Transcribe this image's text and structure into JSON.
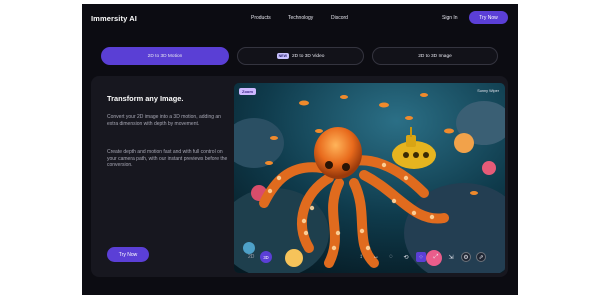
{
  "header": {
    "logo": "Immersity AI",
    "nav": [
      "Products",
      "Technology",
      "Discord"
    ],
    "signin": "Sign In",
    "try_now": "Try Now"
  },
  "tabs": [
    {
      "label": "2D to 3D Motion",
      "active": true
    },
    {
      "label": "2D to 3D Video",
      "badge": "NEW"
    },
    {
      "label": "2D to 3D Image"
    }
  ],
  "feature": {
    "title": "Transform any Image.",
    "paragraph_1": "Convert your 2D image into a 3D motion, adding an extra dimension with depth by movement.",
    "paragraph_2": "Create depth and motion fast and with full control on your camera path, with our instant previews before the conversion.",
    "cta": "Try Now"
  },
  "media": {
    "badge": "Zoom",
    "credit": "Sunny Wiper",
    "toolbar": {
      "mode_2d": "2D",
      "mode_3d": "3D",
      "tools": [
        "vertical-arrows-icon",
        "horizontal-arrows-icon",
        "circle-path-icon",
        "orbit-icon",
        "zoom-grid-icon",
        "expand-icon",
        "dolly-icon",
        "settings-icon",
        "export-icon"
      ]
    }
  },
  "colors": {
    "accent": "#5b3fd6",
    "card_bg": "#17171f",
    "page_bg": "#0c0c12"
  }
}
